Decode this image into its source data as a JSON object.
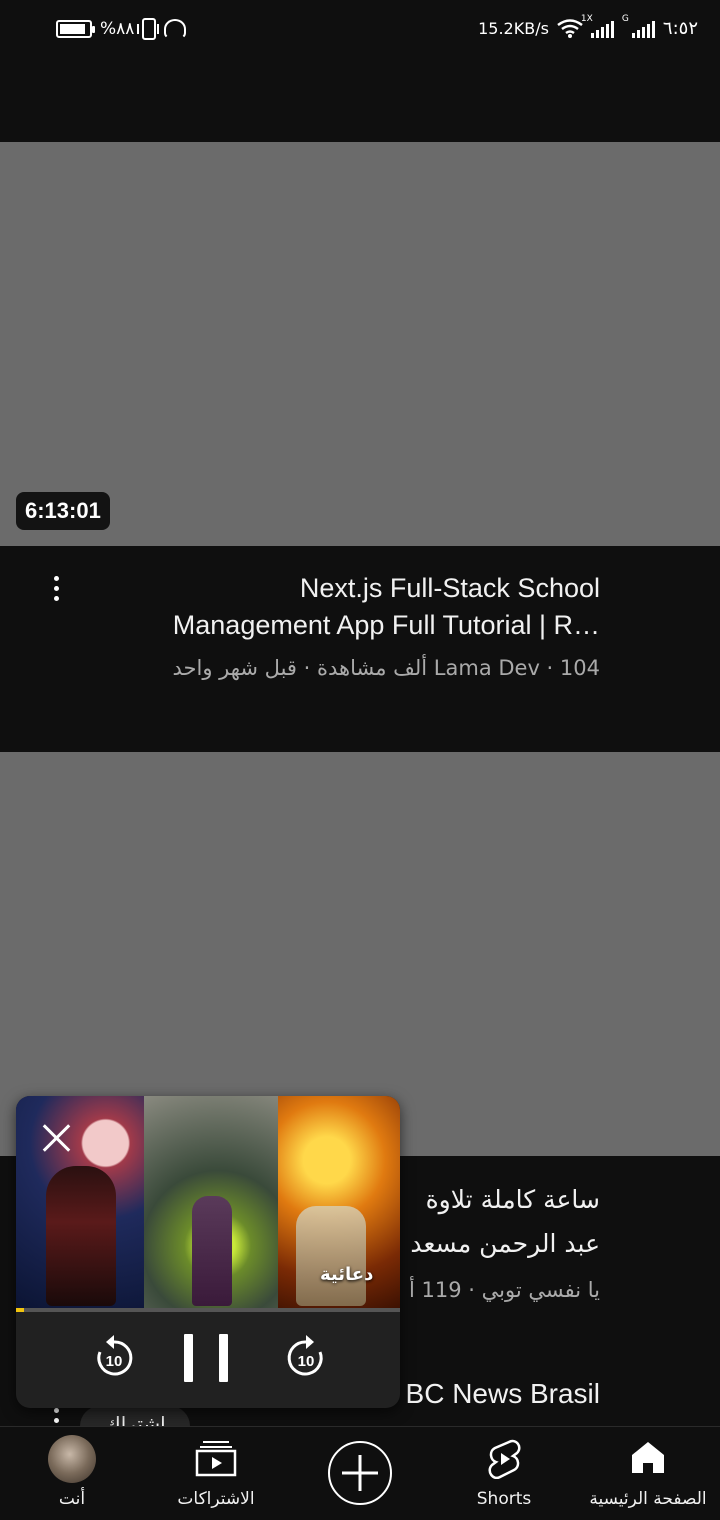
{
  "status_bar": {
    "battery_percent": "%٨٨",
    "battery_level": 0.88,
    "net_speed": "15.2KB/s",
    "sim1_tag": "1X",
    "sim2_tag": "G",
    "time": "٦:٥٢"
  },
  "feed": {
    "video1": {
      "duration": "6:13:01",
      "title_line1": "Next.js Full-Stack School",
      "title_line2": "Management App Full Tutorial | R…",
      "meta": "Lama Dev · 104 ألف مشاهدة · قبل شهر واحد"
    },
    "video2": {
      "title_line1": "ساعة كاملة  تلاوة",
      "title_line2": "عبد الرحمن مسعد",
      "meta": "يا نفسي توبي · 119 أ"
    },
    "video3": {
      "title_partial": "BC News Brasil",
      "subscribe_label": "اشتراك"
    }
  },
  "mini_player": {
    "ad_label": "دعائية",
    "progress": 0.02,
    "rewind_seconds": "10",
    "forward_seconds": "10",
    "progress_color": "#f1c40f"
  },
  "bottom_nav": {
    "items": [
      {
        "label": "أنت",
        "icon": "avatar"
      },
      {
        "label": "الاشتراكات",
        "icon": "subscriptions-icon"
      },
      {
        "label": "",
        "icon": "create-icon"
      },
      {
        "label": "Shorts",
        "icon": "shorts-icon"
      },
      {
        "label": "الصفحة الرئيسية",
        "icon": "home-icon"
      }
    ]
  }
}
